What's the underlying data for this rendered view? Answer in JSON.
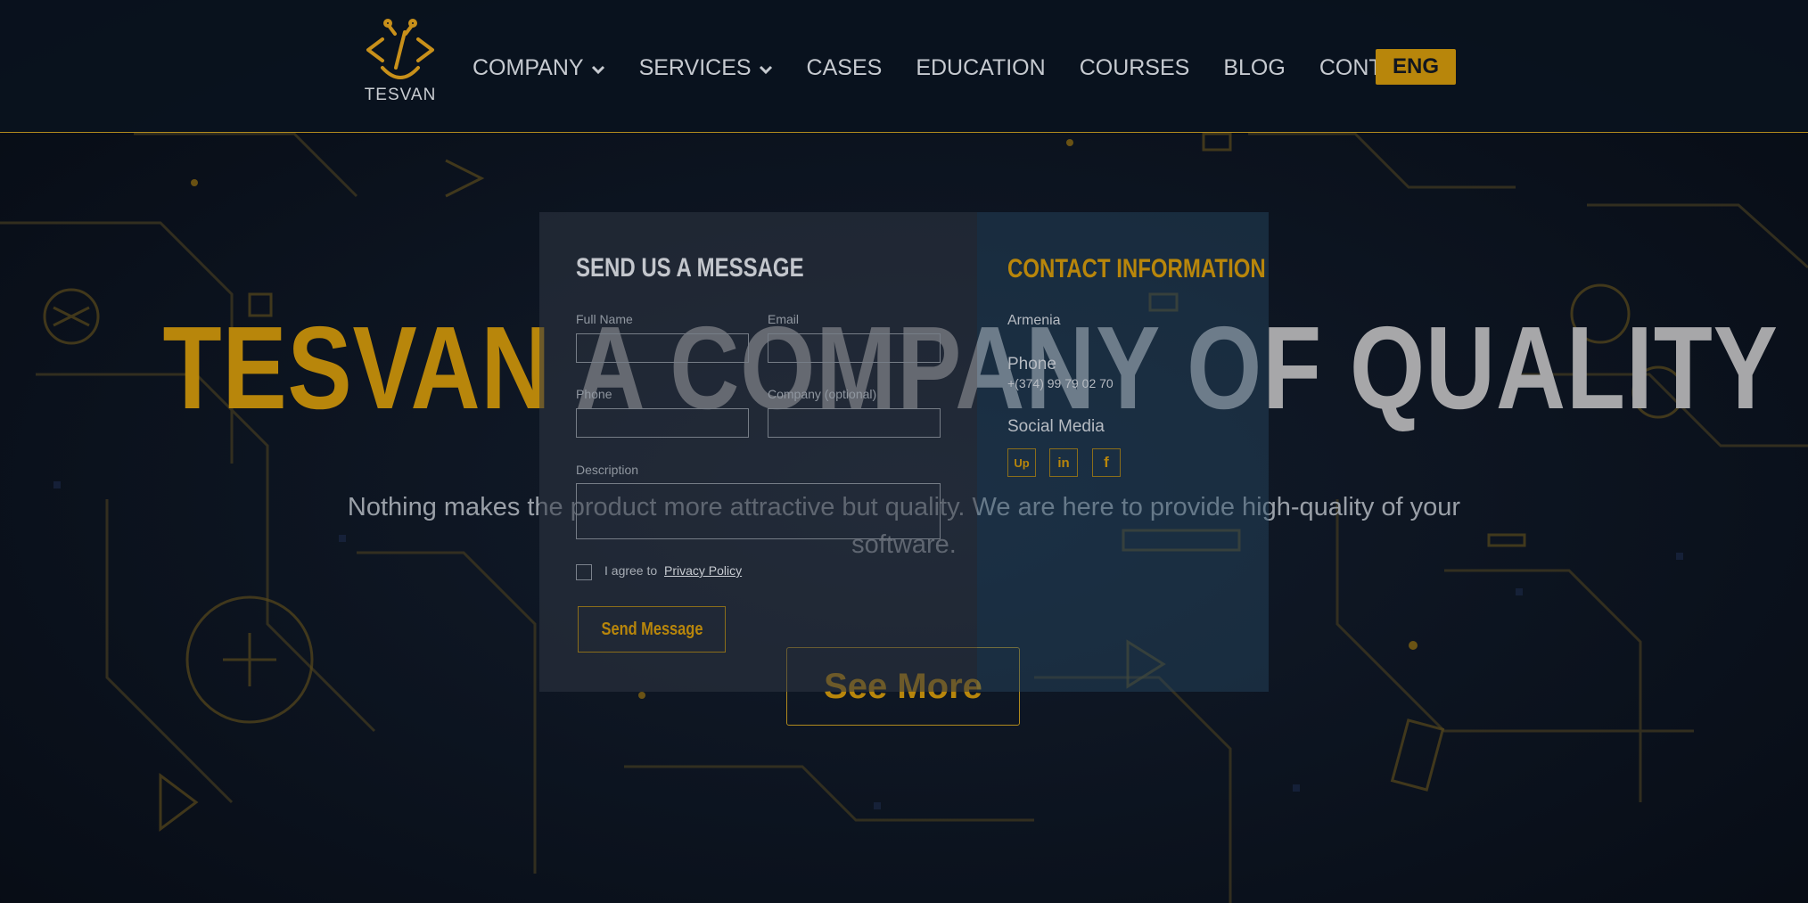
{
  "brand": {
    "logo_text": "TESVAN",
    "accent": "#b8860b"
  },
  "nav": {
    "items": [
      {
        "label": "COMPANY",
        "dropdown": true
      },
      {
        "label": "SERVICES",
        "dropdown": true
      },
      {
        "label": "CASES",
        "dropdown": false
      },
      {
        "label": "EDUCATION",
        "dropdown": false
      },
      {
        "label": "COURSES",
        "dropdown": false
      },
      {
        "label": "BLOG",
        "dropdown": false
      },
      {
        "label": "CONTACTS",
        "dropdown": false
      }
    ],
    "language": "ENG"
  },
  "hero": {
    "title_brand": "TESVAN",
    "title_rest": "A COMPANY OF QUALITY",
    "subtitle": "Nothing makes the product more attractive but quality. We are here to provide high-quality of your software.",
    "see_more": "See More"
  },
  "contact_form": {
    "title": "SEND US A MESSAGE",
    "full_name_label": "Full Name",
    "full_name_value": "",
    "email_label": "Email",
    "email_value": "",
    "phone_label": "Phone",
    "phone_value": "",
    "company_label": "Company (optional)",
    "company_value": "",
    "description_label": "Description",
    "description_value": "",
    "agree_text": "I agree to",
    "privacy_link": "Privacy Policy",
    "send_label": "Send Message"
  },
  "contact_info": {
    "title": "CONTACT INFORMATION",
    "country": "Armenia",
    "phone_label": "Phone",
    "phone_value": "+(374) 99 79 02 70",
    "social_label": "Social Media",
    "social": [
      {
        "icon": "upwork-icon",
        "glyph": "Up"
      },
      {
        "icon": "linkedin-icon",
        "glyph": "in"
      },
      {
        "icon": "facebook-icon",
        "glyph": "f"
      }
    ]
  }
}
